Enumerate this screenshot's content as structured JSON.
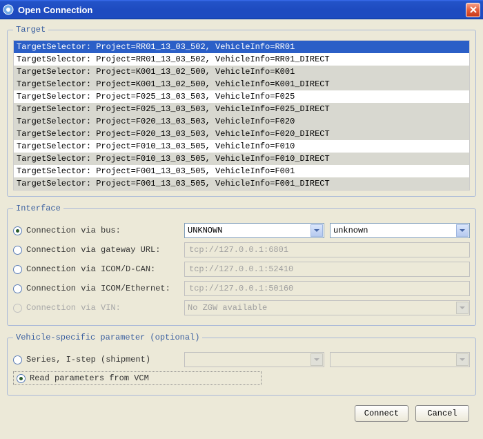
{
  "window": {
    "title": "Open Connection"
  },
  "target": {
    "legend": "Target",
    "rows": [
      "TargetSelector: Project=RR01_13_03_502, VehicleInfo=RR01",
      "TargetSelector: Project=RR01_13_03_502, VehicleInfo=RR01_DIRECT",
      "TargetSelector: Project=K001_13_02_500, VehicleInfo=K001",
      "TargetSelector: Project=K001_13_02_500, VehicleInfo=K001_DIRECT",
      "TargetSelector: Project=F025_13_03_503, VehicleInfo=F025",
      "TargetSelector: Project=F025_13_03_503, VehicleInfo=F025_DIRECT",
      "TargetSelector: Project=F020_13_03_503, VehicleInfo=F020",
      "TargetSelector: Project=F020_13_03_503, VehicleInfo=F020_DIRECT",
      "TargetSelector: Project=F010_13_03_505, VehicleInfo=F010",
      "TargetSelector: Project=F010_13_03_505, VehicleInfo=F010_DIRECT",
      "TargetSelector: Project=F001_13_03_505, VehicleInfo=F001",
      "TargetSelector: Project=F001_13_03_505, VehicleInfo=F001_DIRECT"
    ]
  },
  "interface": {
    "legend": "Interface",
    "bus": {
      "label": "Connection via bus:",
      "combo1": "UNKNOWN",
      "combo2": "unknown"
    },
    "gateway": {
      "label": "Connection via gateway URL:",
      "value": "tcp://127.0.0.1:6801"
    },
    "dcan": {
      "label": "Connection via ICOM/D-CAN:",
      "value": "tcp://127.0.0.1:52410"
    },
    "eth": {
      "label": "Connection via ICOM/Ethernet:",
      "value": "tcp://127.0.0.1:50160"
    },
    "vin": {
      "label": "Connection via VIN:",
      "value": "No ZGW available"
    }
  },
  "vehicle": {
    "legend": "Vehicle-specific parameter (optional)",
    "series": {
      "label": "Series, I-step (shipment)"
    },
    "vcm": {
      "label": "Read parameters from VCM"
    }
  },
  "buttons": {
    "connect": "Connect",
    "cancel": "Cancel"
  }
}
